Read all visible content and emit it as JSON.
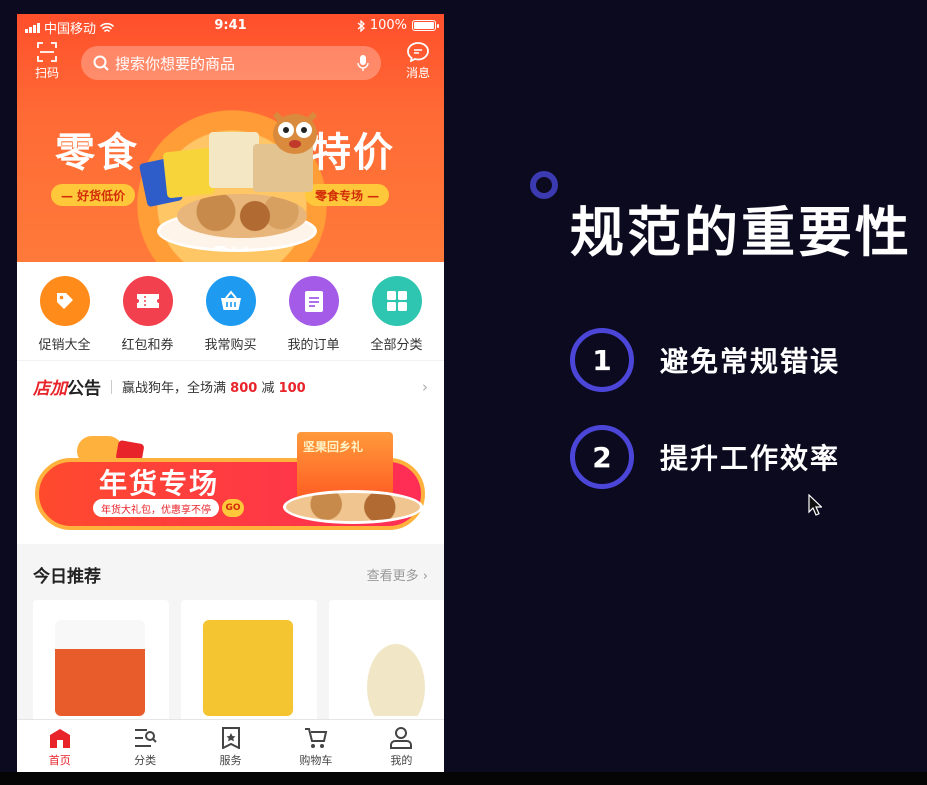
{
  "status_bar": {
    "carrier": "中国移动",
    "time": "9:41",
    "battery": "100%"
  },
  "header": {
    "scan_label": "扫码",
    "search_placeholder": "搜索你想要的商品",
    "message_label": "消息"
  },
  "banner": {
    "left_word": "零食",
    "right_word": "特价",
    "pill_left": "— 好货低价",
    "pill_right": "零食专场 —",
    "slide_count": 3,
    "active_slide": 1
  },
  "categories": [
    {
      "label": "促销大全",
      "color": "#ff8c1a",
      "icon": "tag-icon"
    },
    {
      "label": "红包和券",
      "color": "#f2404e",
      "icon": "ticket-icon"
    },
    {
      "label": "我常购买",
      "color": "#1e9bf0",
      "icon": "basket-icon"
    },
    {
      "label": "我的订单",
      "color": "#a35be8",
      "icon": "order-icon"
    },
    {
      "label": "全部分类",
      "color": "#2ec6b0",
      "icon": "grid-icon"
    }
  ],
  "notice": {
    "brand_red": "店加",
    "brand_dark": "公告",
    "text_prefix": "赢战狗年，全场满",
    "amount1": "800",
    "text_mid": "减",
    "amount2": "100"
  },
  "promo": {
    "title": "年货专场",
    "subtitle": "年货大礼包，优惠享不停",
    "go": "GO",
    "gift_text": "坚果回乡礼"
  },
  "recommend": {
    "title": "今日推荐",
    "more": "查看更多"
  },
  "products": [
    {
      "color": "#e85b2a"
    },
    {
      "color": "#f4c531"
    },
    {
      "color": "#f1e6c6"
    }
  ],
  "tabs": [
    {
      "label": "首页",
      "icon": "home-icon",
      "active": true
    },
    {
      "label": "分类",
      "icon": "category-icon",
      "active": false
    },
    {
      "label": "服务",
      "icon": "service-icon",
      "active": false
    },
    {
      "label": "购物车",
      "icon": "cart-icon",
      "active": false
    },
    {
      "label": "我的",
      "icon": "profile-icon",
      "active": false
    }
  ],
  "slide": {
    "title": "规范的重要性",
    "points": [
      {
        "num": "1",
        "text": "避免常规错误"
      },
      {
        "num": "2",
        "text": "提升工作效率"
      }
    ],
    "accent": "#4b46d8"
  }
}
